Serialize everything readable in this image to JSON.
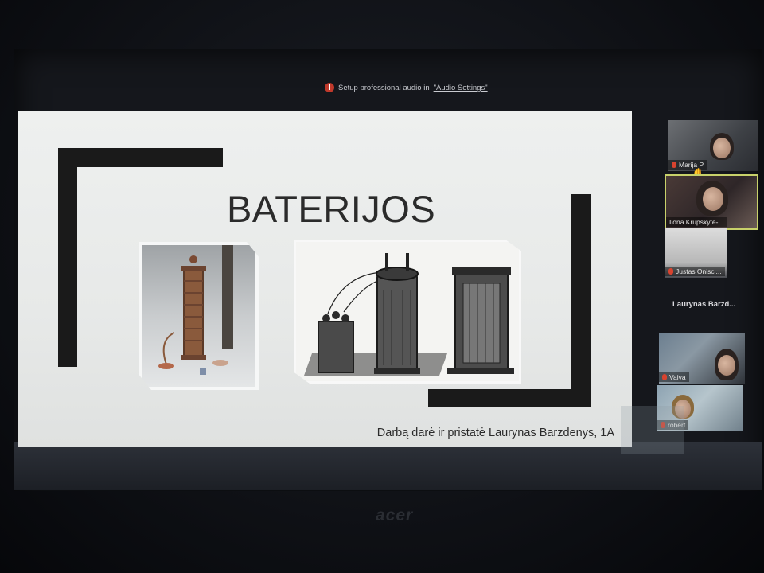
{
  "zoom": {
    "audio_notice_prefix": "Setup professional audio in ",
    "audio_notice_link": "\"Audio Settings\""
  },
  "slide": {
    "title": "BATERIJOS",
    "credit": "Darbą darė ir pristatė Laurynas Barzdenys, 1A"
  },
  "participants": [
    {
      "name": "Marija P"
    },
    {
      "name": "Ilona Krupskytė-..."
    },
    {
      "name": "Justas Onisci..."
    },
    {
      "name": "Laurynas  Barzd..."
    },
    {
      "name": "Vaiva"
    },
    {
      "name": "robert"
    }
  ],
  "device": {
    "brand": "acer"
  },
  "colors": {
    "active_speaker_border": "#c8d16a",
    "muted_mic": "#d9432f"
  }
}
